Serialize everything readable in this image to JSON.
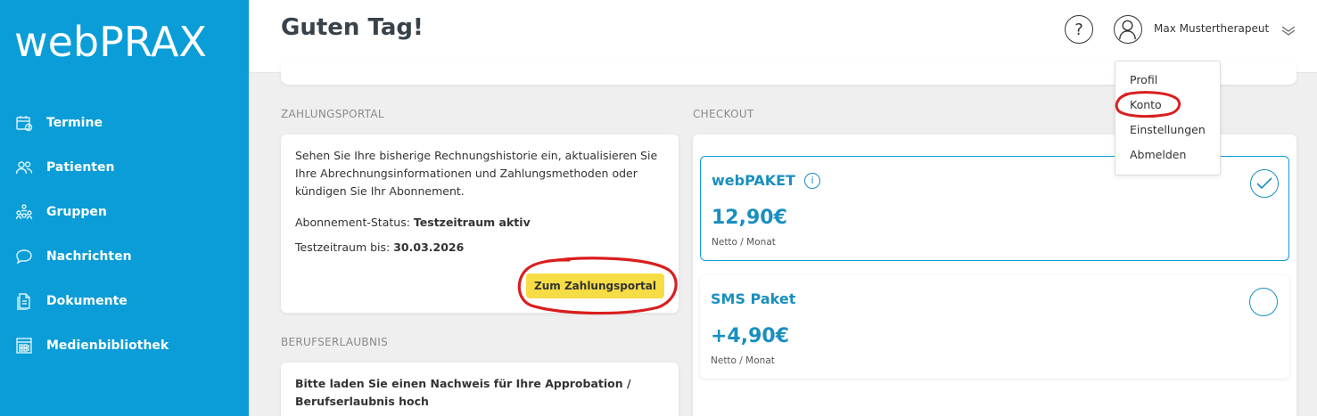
{
  "app": {
    "logo": "webPRAX"
  },
  "sidebar": {
    "items": [
      {
        "label": "Termine",
        "icon": "calendar-icon"
      },
      {
        "label": "Patienten",
        "icon": "people-icon"
      },
      {
        "label": "Gruppen",
        "icon": "group-icon"
      },
      {
        "label": "Nachrichten",
        "icon": "chat-bubble-icon"
      },
      {
        "label": "Dokumente",
        "icon": "document-icon"
      },
      {
        "label": "Medienbibliothek",
        "icon": "media-library-icon"
      }
    ]
  },
  "header": {
    "title": "Guten Tag!",
    "help_symbol": "?",
    "user_name": "Max Mustertherapeut"
  },
  "user_menu": {
    "items": [
      "Profil",
      "Konto",
      "Einstellungen",
      "Abmelden"
    ]
  },
  "zahlungsportal": {
    "section_title": "ZAHLUNGSPORTAL",
    "description": "Sehen Sie Ihre bisherige Rechnungshistorie ein, aktualisieren Sie Ihre Abrechnungsinformationen und Zahlungsmethoden oder kündigen Sie Ihr Abonnement.",
    "status_label": "Abonnement-Status:",
    "status_value": "Testzeitraum aktiv",
    "until_label": "Testzeitraum bis:",
    "until_value": "30.03.2026",
    "button_label": "Zum Zahlungsportal"
  },
  "berufserlaubnis": {
    "section_title": "BERUFSERLAUBNIS",
    "text": "Bitte laden Sie einen Nachweis für Ihre Approbation / Berufserlaubnis hoch"
  },
  "checkout": {
    "section_title": "CHECKOUT",
    "packages": [
      {
        "name": "webPAKET",
        "info_symbol": "i",
        "price": "12,90€",
        "unit": "Netto / Monat",
        "selected": true
      },
      {
        "name": "SMS Paket",
        "price": "+4,90€",
        "unit": "Netto / Monat",
        "selected": false
      }
    ]
  },
  "colors": {
    "sidebar": "#0a9dd8",
    "accent": "#1a8fbf",
    "button_yellow": "#f6dd45",
    "annotation_red": "#d91e1e"
  }
}
